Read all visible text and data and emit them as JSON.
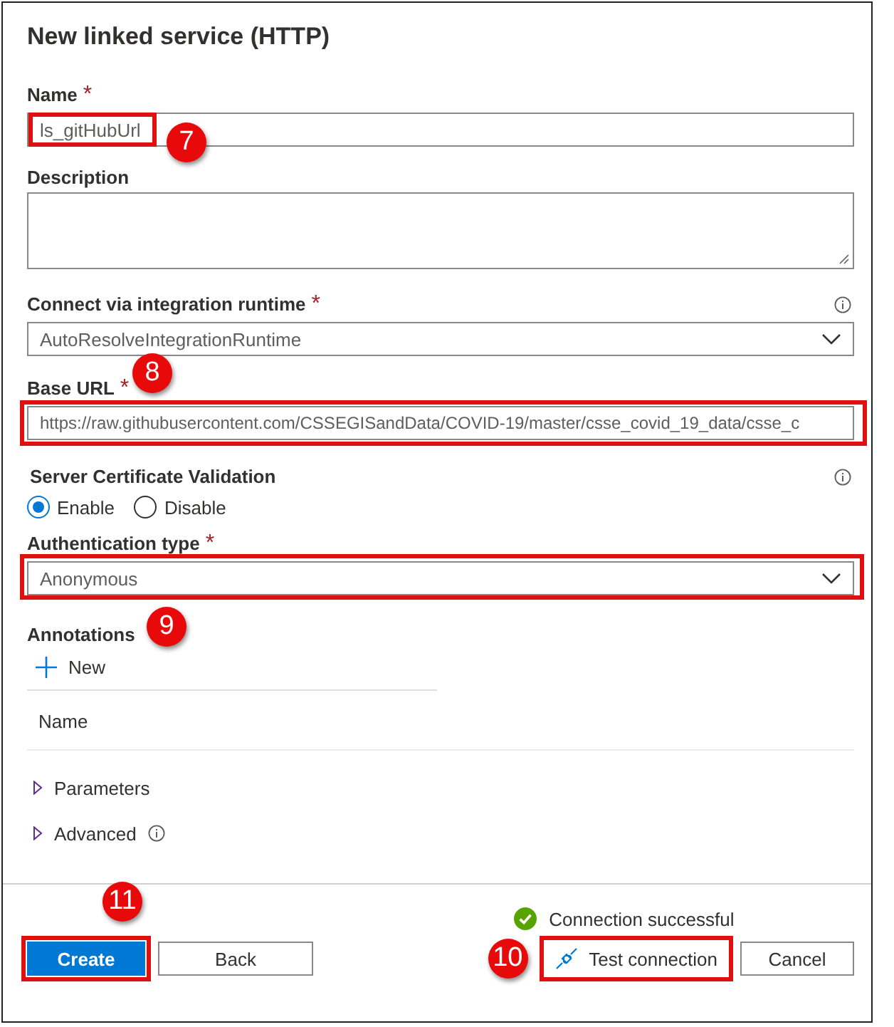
{
  "dialog": {
    "title": "New linked service (HTTP)"
  },
  "fields": [
    {
      "kind": "text",
      "label": "Name",
      "asterisk": "*",
      "value": "ls_gitHubUrl",
      "highlighted": true,
      "callout": "7"
    },
    {
      "kind": "textarea",
      "label": "Description"
    },
    {
      "kind": "select",
      "label": "Connect via integration runtime",
      "asterisk": "*",
      "value": "AutoResolveIntegrationRuntime",
      "info": true
    },
    {
      "kind": "url",
      "label": "Base URL",
      "asterisk": "*",
      "value": "https://raw.githubusercontent.com/CSSEGISandData/COVID-19/master/csse_covid_19_data/csse_c",
      "highlighted": true,
      "callout": "8"
    },
    {
      "kind": "radio",
      "label": "Server Certificate Validation",
      "info": true,
      "options": [
        {
          "label": "Enable",
          "selected": true
        },
        {
          "label": "Disable",
          "selected": false
        }
      ]
    },
    {
      "kind": "select",
      "label": "Authentication type",
      "asterisk": "*",
      "value": "Anonymous",
      "highlighted": true
    }
  ],
  "annotations": {
    "title": "Annotations",
    "callout": "9",
    "add_label": "New",
    "column": "Name"
  },
  "sections": [
    {
      "label": "Parameters",
      "expanded": false
    },
    {
      "label": "Advanced",
      "expanded": false,
      "info": true
    }
  ],
  "status": {
    "kind": "success",
    "text": "Connection successful"
  },
  "left_buttons": [
    {
      "label": "Create",
      "primary": true,
      "highlighted": true,
      "callout": "11"
    },
    {
      "label": "Back",
      "primary": false
    }
  ],
  "right_buttons": [
    {
      "kind": "with-icon",
      "label": "Test connection",
      "highlighted": true,
      "callout": "10"
    },
    {
      "kind": "plain",
      "label": "Cancel"
    }
  ]
}
